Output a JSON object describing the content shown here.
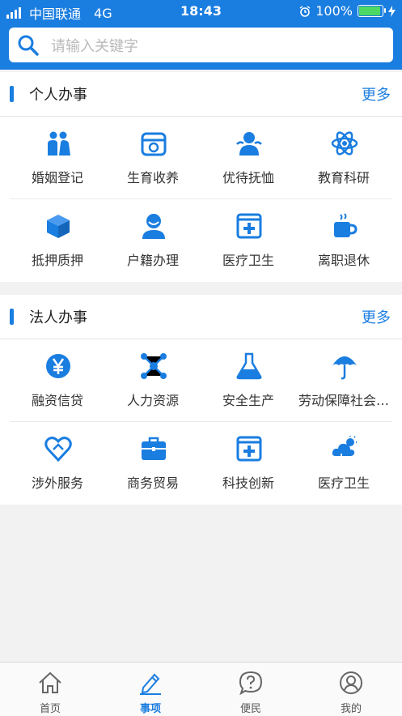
{
  "status_bar": {
    "carrier": "中国联通",
    "network": "4G",
    "time": "18:43",
    "battery": "100%"
  },
  "search": {
    "placeholder": "请输入关键字",
    "icon": "search-icon"
  },
  "colors": {
    "accent": "#1a7de0",
    "battery": "#4cd964"
  },
  "personal": {
    "title": "个人办事",
    "more": "更多",
    "items": [
      {
        "label": "婚姻登记",
        "icon": "couple-icon"
      },
      {
        "label": "生育收养",
        "icon": "baby-food-icon"
      },
      {
        "label": "优待抚恤",
        "icon": "people-icon"
      },
      {
        "label": "教育科研",
        "icon": "atom-icon"
      },
      {
        "label": "抵押质押",
        "icon": "box-icon"
      },
      {
        "label": "户籍办理",
        "icon": "person-icon"
      },
      {
        "label": "医疗卫生",
        "icon": "medical-cross-icon"
      },
      {
        "label": "离职退休",
        "icon": "coffee-cup-icon"
      }
    ]
  },
  "legal": {
    "title": "法人办事",
    "more": "更多",
    "items": [
      {
        "label": "融资信贷",
        "icon": "yen-coin-icon"
      },
      {
        "label": "人力资源",
        "icon": "network-icon"
      },
      {
        "label": "安全生产",
        "icon": "flask-icon"
      },
      {
        "label": "劳动保障社会…",
        "icon": "umbrella-icon"
      },
      {
        "label": "涉外服务",
        "icon": "heart-icon"
      },
      {
        "label": "商务贸易",
        "icon": "briefcase-icon"
      },
      {
        "label": "科技创新",
        "icon": "medical-cross-icon"
      },
      {
        "label": "医疗卫生",
        "icon": "weather-icon"
      }
    ]
  },
  "tabbar": {
    "tabs": [
      {
        "label": "首页",
        "icon": "home-icon"
      },
      {
        "label": "事项",
        "icon": "pencil-icon",
        "active": true
      },
      {
        "label": "便民",
        "icon": "question-bubble-icon"
      },
      {
        "label": "我的",
        "icon": "user-circle-icon"
      }
    ]
  }
}
